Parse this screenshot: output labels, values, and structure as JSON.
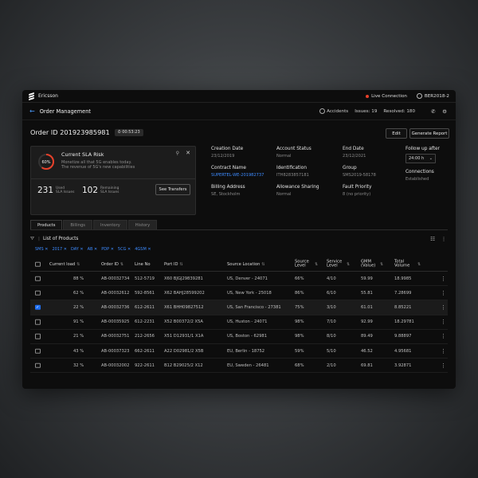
{
  "app": {
    "brand": "Ericsson",
    "live": "Live Connection",
    "user": "BER2018-2"
  },
  "subheader": {
    "title": "Order Management",
    "accidents": "Accidents",
    "issues": "Issues: 19",
    "resolved": "Resolved: 180"
  },
  "order": {
    "id": "Order ID 201923985981",
    "timer": "00:53:23",
    "edit": "Edit",
    "report": "Generate Report"
  },
  "sla": {
    "percent": "60%",
    "percent_value": 60,
    "title": "Current SLA Risk",
    "desc1": "Monetize all that 5G enables today.",
    "desc2": "The revenue of 5G's new capabilities",
    "used_num": "231",
    "used_lbl1": "Used",
    "used_lbl2": "SLA Issues",
    "rem_num": "102",
    "rem_lbl1": "Remaining",
    "rem_lbl2": "SLA Issues",
    "see": "See Transfers"
  },
  "details": {
    "creation_k": "Creation Date",
    "creation_v": "23/12/2019",
    "status_k": "Account Status",
    "status_v": "Normal",
    "end_k": "End Date",
    "end_v": "23/12/2021",
    "contract_k": "Contract Name",
    "contract_v": "SUPERTEL-WE-201982737",
    "ident_k": "Identification",
    "ident_v": "ITH8283857181",
    "group_k": "Group",
    "group_v": "SMS2019-58178",
    "billing_k": "Billing Address",
    "billing_v": "SE, Stockholm",
    "allow_k": "Allowance Sharing",
    "allow_v": "Normal",
    "fault_k": "Fault Priority",
    "fault_v": "8 (no priority)",
    "follow_k": "Follow up after",
    "follow_v": "24:00 h",
    "conn_k": "Connections",
    "conn_v": "Established"
  },
  "tabs": [
    "Products",
    "Billings",
    "Inventory",
    "History"
  ],
  "list": {
    "title": "List of Products",
    "chips": [
      "SMS ✕",
      "2017 ✕",
      "DAY ✕",
      "AB ✕",
      "PDP ✕",
      "5CG ✕",
      "4GSM ✕"
    ]
  },
  "table": {
    "headers": [
      "Current load",
      "Order ID",
      "Line No",
      "Port ID",
      "Source Location",
      "Source Level",
      "Service Level",
      "GMM (Value)",
      "Total Volume"
    ],
    "rows": [
      {
        "load": "88 %",
        "fill": 0.88,
        "order": "AB-00032734",
        "line": "512-5719",
        "port": "X60 BJGJ29839281",
        "loc": "US, Denver - 24071",
        "src": "66%",
        "svc": "4/10",
        "gmm": "59.99",
        "vol": "18.9985",
        "sel": false
      },
      {
        "load": "62 %",
        "fill": 0.62,
        "order": "AB-00032612",
        "line": "592-8561",
        "port": "X62 BAHJ28599202",
        "loc": "US, New York - 25018",
        "src": "86%",
        "svc": "6/10",
        "gmm": "55.81",
        "vol": "7.28699",
        "sel": false
      },
      {
        "load": "22 %",
        "fill": 0.22,
        "order": "AB-00032736",
        "line": "612-2611",
        "port": "X61 BHH09827512",
        "loc": "US, San Francisco - 27381",
        "src": "75%",
        "svc": "3/10",
        "gmm": "61.01",
        "vol": "8.85221",
        "sel": true
      },
      {
        "load": "91 %",
        "fill": 0.91,
        "order": "AB-00035925",
        "line": "612-2231",
        "port": "X52 B00372/2 X5A",
        "loc": "US, Huston - 24071",
        "src": "98%",
        "svc": "7/10",
        "gmm": "92.99",
        "vol": "18.29781",
        "sel": false
      },
      {
        "load": "21 %",
        "fill": 0.21,
        "order": "AB-00032751",
        "line": "212-2656",
        "port": "X51 D12931/1 X1A",
        "loc": "US, Boston - 62981",
        "src": "98%",
        "svc": "8/10",
        "gmm": "89.49",
        "vol": "9.88897",
        "sel": false
      },
      {
        "load": "43 %",
        "fill": 0.43,
        "order": "AB-00037323",
        "line": "662-2611",
        "port": "A22 D02981/2 X5B",
        "loc": "EU, Berlin - 18752",
        "src": "59%",
        "svc": "5/10",
        "gmm": "46.52",
        "vol": "4.95681",
        "sel": false
      },
      {
        "load": "32 %",
        "fill": 0.32,
        "order": "AB-00032002",
        "line": "922-2611",
        "port": "B12 B29025/2 X12",
        "loc": "EU, Sweden - 26481",
        "src": "68%",
        "svc": "2/10",
        "gmm": "69.81",
        "vol": "3.92871",
        "sel": false
      }
    ]
  }
}
